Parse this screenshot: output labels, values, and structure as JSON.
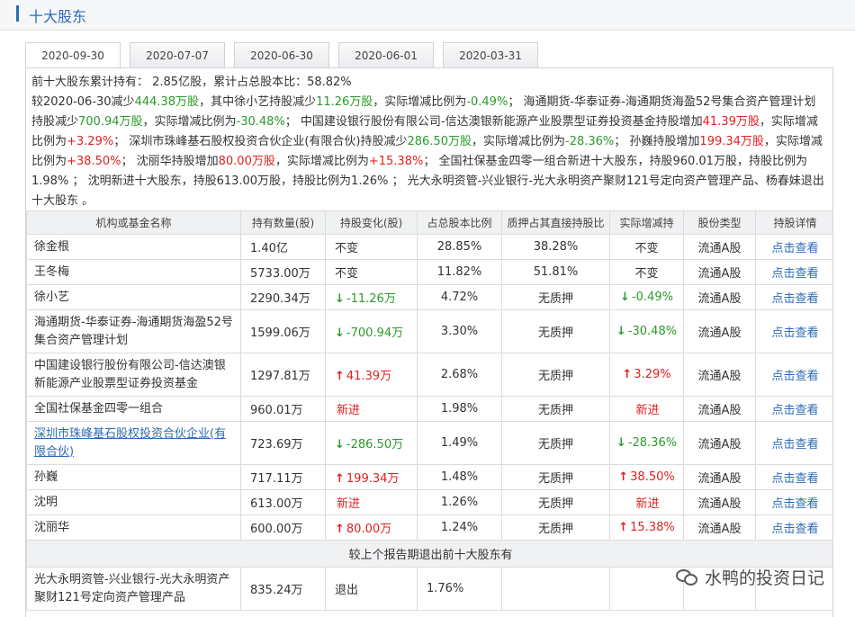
{
  "section": {
    "title": "十大股东"
  },
  "tabs": [
    "2020-09-30",
    "2020-07-07",
    "2020-06-30",
    "2020-06-01",
    "2020-03-31"
  ],
  "summary": {
    "p1": "前十大股东累计持有： 2.85亿股，累计占总股本比：58.82%",
    "s1": "较2020-06-30减少",
    "v1": "444.38万股",
    "s2": "，其中徐小艺持股减少",
    "v2": "11.26万股",
    "s3": "，实际增减比例为",
    "v3": "-0.49%",
    "s4": "；  海通期货-华泰证券-海通期货海盈52号集合资产管理计划持股减少",
    "v4": "700.94万股",
    "s5": "，实际增减比例为",
    "v5": "-30.48%",
    "s6": "；  中国建设银行股份有限公司-信达澳银新能源产业股票型证券投资基金持股增加",
    "v6": "41.39万股",
    "s7": "，实际增减比例为",
    "v7": "+3.29%",
    "s8": "；  深圳市珠峰基石股权投资合伙企业(有限合伙)持股减少",
    "v8": "286.50万股",
    "s9": "，实际增减比例为",
    "v9": "-28.36%",
    "s10": "；  孙巍持股增加",
    "v10": "199.34万股",
    "s11": "，实际增减比例为",
    "v11": "+38.50%",
    "s12": "；  沈丽华持股增加",
    "v12": "80.00万股",
    "s13": "，实际增减比例为",
    "v13": "+15.38%",
    "s14": "；  全国社保基金四零一组合新进十大股东，持股960.01万股，持股比例为1.98%  ；  沈明新进十大股东，持股613.00万股，持股比例为1.26%  ；  光大永明资管-兴业银行-光大永明资产聚财121号定向资产管理产品、杨春妹退出十大股东  。"
  },
  "table": {
    "headers": [
      "机构或基金名称",
      "持有数量(股)",
      "持股变化(股)",
      "占总股本比例",
      "质押占其直接持股比",
      "实际增减持",
      "股份类型",
      "持股详情"
    ],
    "rows": [
      {
        "name": "徐金根",
        "qty": "1.40亿",
        "change": "不变",
        "dir": "",
        "pct": "28.85%",
        "pledge": "38.28%",
        "actual": "不变",
        "adir": "",
        "type": "流通A股",
        "detail": "点击查看"
      },
      {
        "name": "王冬梅",
        "qty": "5733.00万",
        "change": "不变",
        "dir": "",
        "pct": "11.82%",
        "pledge": "51.81%",
        "actual": "不变",
        "adir": "",
        "type": "流通A股",
        "detail": "点击查看"
      },
      {
        "name": "徐小艺",
        "qty": "2290.34万",
        "change": "-11.26万",
        "dir": "dn",
        "pct": "4.72%",
        "pledge": "无质押",
        "actual": "-0.49%",
        "adir": "dn",
        "type": "流通A股",
        "detail": "点击查看"
      },
      {
        "name": "海通期货-华泰证券-海通期货海盈52号集合资产管理计划",
        "qty": "1599.06万",
        "change": "-700.94万",
        "dir": "dn",
        "pct": "3.30%",
        "pledge": "无质押",
        "actual": "-30.48%",
        "adir": "dn",
        "type": "流通A股",
        "detail": "点击查看"
      },
      {
        "name": "中国建设银行股份有限公司-信达澳银新能源产业股票型证券投资基金",
        "qty": "1297.81万",
        "change": "41.39万",
        "dir": "up",
        "pct": "2.68%",
        "pledge": "无质押",
        "actual": "3.29%",
        "adir": "up",
        "type": "流通A股",
        "detail": "点击查看"
      },
      {
        "name": "全国社保基金四零一组合",
        "qty": "960.01万",
        "change": "新进",
        "dir": "new",
        "pct": "1.98%",
        "pledge": "无质押",
        "actual": "新进",
        "adir": "new",
        "type": "流通A股",
        "detail": "点击查看"
      },
      {
        "name": "深圳市珠峰基石股权投资合伙企业(有限合伙)",
        "qty": "723.69万",
        "change": "-286.50万",
        "dir": "dn",
        "pct": "1.49%",
        "pledge": "无质押",
        "actual": "-28.36%",
        "adir": "dn",
        "type": "流通A股",
        "detail": "点击查看"
      },
      {
        "name": "孙巍",
        "qty": "717.11万",
        "change": "199.34万",
        "dir": "up",
        "pct": "1.48%",
        "pledge": "无质押",
        "actual": "38.50%",
        "adir": "up",
        "type": "流通A股",
        "detail": "点击查看"
      },
      {
        "name": "沈明",
        "qty": "613.00万",
        "change": "新进",
        "dir": "new",
        "pct": "1.26%",
        "pledge": "无质押",
        "actual": "新进",
        "adir": "new",
        "type": "流通A股",
        "detail": "点击查看"
      },
      {
        "name": "沈丽华",
        "qty": "600.00万",
        "change": "80.00万",
        "dir": "up",
        "pct": "1.24%",
        "pledge": "无质押",
        "actual": "15.38%",
        "adir": "up",
        "type": "流通A股",
        "detail": "点击查看"
      }
    ],
    "exit_header": "较上个报告期退出前十大股东有",
    "exit_rows": [
      {
        "name": "光大永明资管-兴业银行-光大永明资产聚财121号定向资产管理产品",
        "qty": "835.24万",
        "change": "退出",
        "pct": "1.76%"
      }
    ]
  },
  "watermark": {
    "text": "水鸭的投资日记",
    "icon": "wechat-icon"
  },
  "colors": {
    "accent": "#2d6bb5",
    "increase": "#e02020",
    "decrease": "#2b9a2b"
  }
}
